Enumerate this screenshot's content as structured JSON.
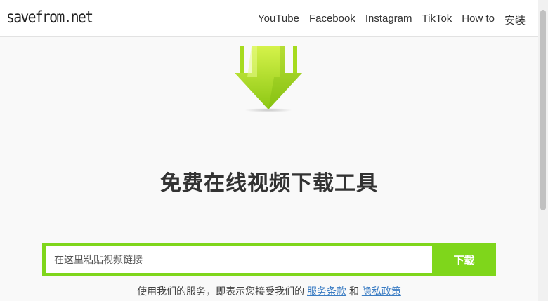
{
  "header": {
    "logo": "savefrom.net",
    "nav": [
      "YouTube",
      "Facebook",
      "Instagram",
      "TikTok",
      "How to",
      "安装"
    ]
  },
  "hero": {
    "title": "免费在线视频下载工具",
    "icon": "download-arrow-icon",
    "colors": {
      "accent": "#7fd61b",
      "arrow_light": "#c7ee3a",
      "arrow_dark": "#7ab60f"
    }
  },
  "form": {
    "placeholder": "在这里粘贴视频链接",
    "button_label": "下载"
  },
  "terms": {
    "prefix": "使用我们的服务，即表示您接受我们的",
    "link1": "服务条款",
    "middle": "和",
    "link2": "隐私政策"
  }
}
